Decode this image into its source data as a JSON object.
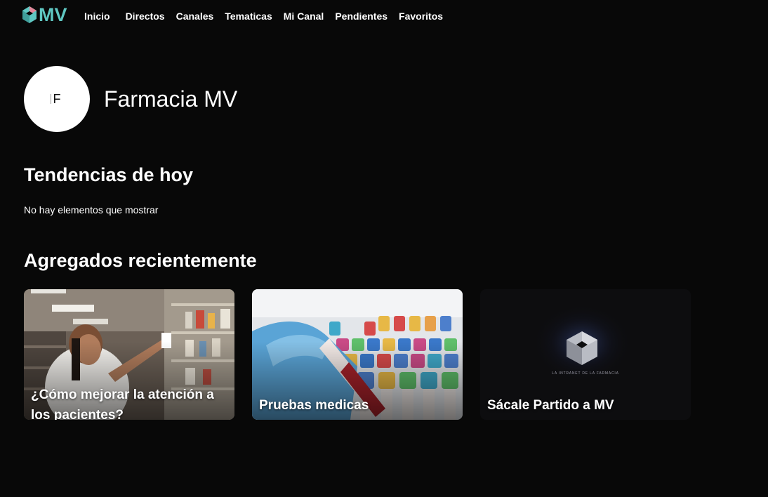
{
  "header": {
    "logo_text": "MV",
    "nav": [
      "Inicio",
      "Directos",
      "Canales",
      "Tematicas",
      "Mi Canal",
      "Pendientes",
      "Favoritos"
    ]
  },
  "profile": {
    "avatar_initial": "F",
    "name": "Farmacia MV"
  },
  "trends": {
    "title": "Tendencias de hoy",
    "empty_message": "No hay elementos que mostrar"
  },
  "recent": {
    "title": "Agregados recientemente",
    "cards": [
      {
        "title": "¿Cómo mejorar la atención a los pacientes?"
      },
      {
        "title": "Pruebas medicas"
      },
      {
        "title": "Sácale Partido a MV",
        "thumb_caption": "LA INTRANET DE LA FARMACIA"
      }
    ]
  },
  "colors": {
    "background": "#080808",
    "brand_teal": "#5fc7c2",
    "brand_pink": "#e3879a"
  }
}
